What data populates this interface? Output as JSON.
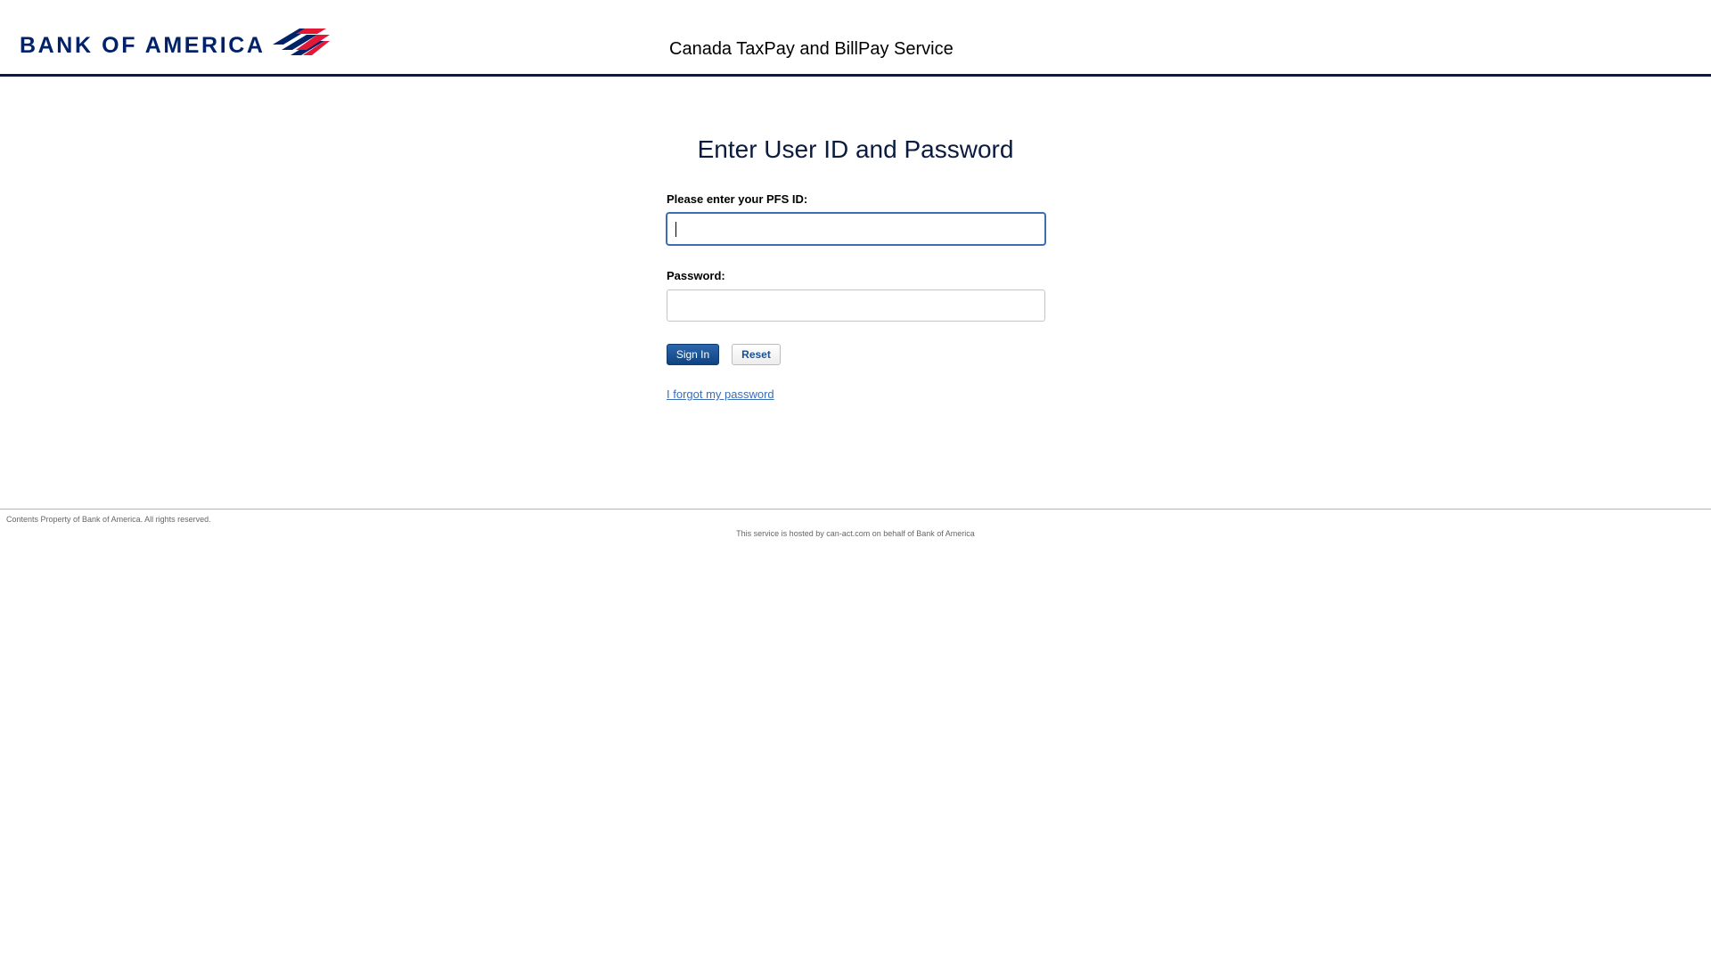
{
  "header": {
    "logo_text": "BANK OF AMERICA",
    "service_title": "Canada TaxPay and BillPay Service",
    "brand_colors": {
      "navy": "#012169",
      "red": "#e31837"
    }
  },
  "main": {
    "heading": "Enter User ID and Password",
    "pfs_id": {
      "label": "Please enter your PFS ID:",
      "value": ""
    },
    "password": {
      "label": "Password:",
      "value": ""
    },
    "sign_in_label": "Sign In",
    "reset_label": "Reset",
    "forgot_link": "I forgot my password"
  },
  "footer": {
    "copyright": "Contents Property of Bank of America. All rights reserved.",
    "hosted_note": "This service is hosted by can-act.com on behalf of Bank of America"
  }
}
